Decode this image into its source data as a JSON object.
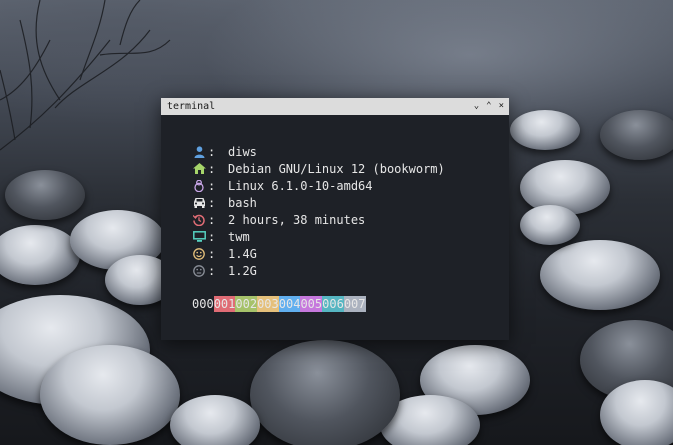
{
  "window": {
    "title": "terminal",
    "controls": {
      "minimize": "⌄",
      "maximize": "⌃",
      "close": "×"
    }
  },
  "info": [
    {
      "icon": "user-icon",
      "color": "#5fa0e0",
      "sep": ":",
      "value": "diws"
    },
    {
      "icon": "home-icon",
      "color": "#a6d56a",
      "sep": ":",
      "value": "Debian GNU/Linux 12 (bookworm)"
    },
    {
      "icon": "tux-icon",
      "color": "#c9a6e8",
      "sep": ":",
      "value": "Linux 6.1.0-10-amd64"
    },
    {
      "icon": "car-icon",
      "color": "#e6e6e6",
      "sep": ":",
      "value": "bash"
    },
    {
      "icon": "history-icon",
      "color": "#e06c75",
      "sep": ":",
      "value": "2 hours, 38 minutes"
    },
    {
      "icon": "monitor-icon",
      "color": "#56d0c0",
      "sep": ":",
      "value": "twm"
    },
    {
      "icon": "smile-icon",
      "color": "#e5c07b",
      "sep": ":",
      "value": "1.4G"
    },
    {
      "icon": "neutral-face-icon",
      "color": "#8a8f98",
      "sep": ":",
      "value": "1.2G"
    }
  ],
  "palette": [
    {
      "label": "000",
      "bg": "#1e2127"
    },
    {
      "label": "001",
      "bg": "#e06c75"
    },
    {
      "label": "002",
      "bg": "#a6c26a"
    },
    {
      "label": "003",
      "bg": "#e5c07b"
    },
    {
      "label": "004",
      "bg": "#61afef"
    },
    {
      "label": "005",
      "bg": "#c678dd"
    },
    {
      "label": "006",
      "bg": "#56b6c2"
    },
    {
      "label": "007",
      "bg": "#abb2bf"
    }
  ]
}
